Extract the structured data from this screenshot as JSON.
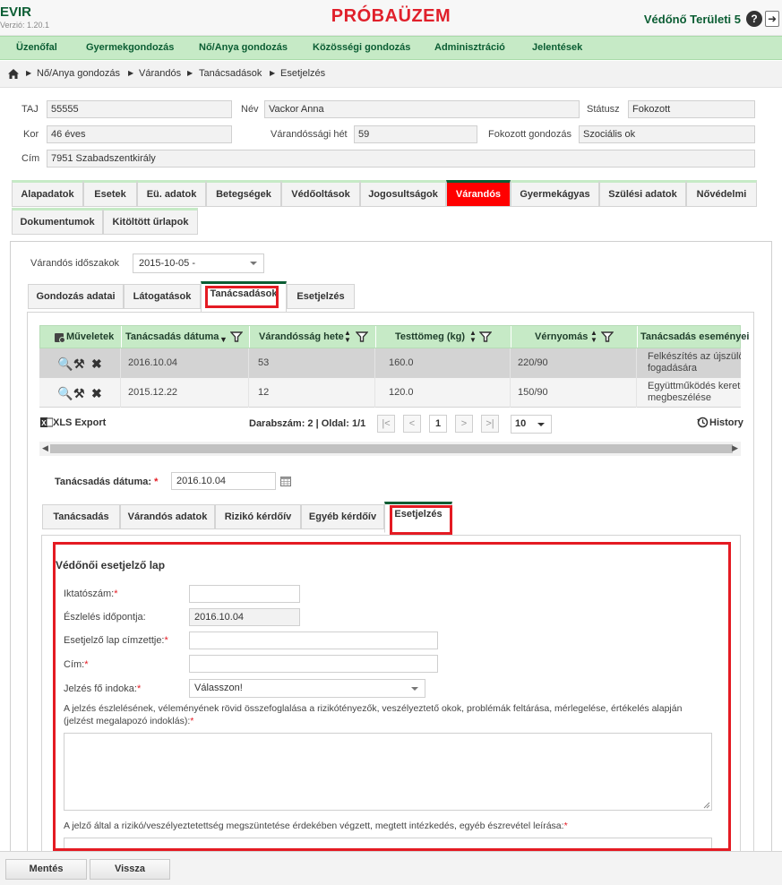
{
  "header": {
    "app_name": "EVIR",
    "version": "Verzió: 1.20.1",
    "env_banner": "PRÓBAÜZEM",
    "user": "Védőnő Területi 5",
    "help": "?",
    "logout": "➜"
  },
  "main_menu": [
    "Üzenőfal",
    "Gyermekgondozás",
    "Nő/Anya gondozás",
    "Közösségi gondozás",
    "Adminisztráció",
    "Jelentések"
  ],
  "breadcrumb": [
    "Nő/Anya gondozás",
    "Várandós",
    "Tanácsadások",
    "Esetjelzés"
  ],
  "patient": {
    "taj_label": "TAJ",
    "taj": "55555",
    "name_label": "Név",
    "name": "Vackor Anna",
    "status_label": "Státusz",
    "status": "Fokozott",
    "age_label": "Kor",
    "age": "46 éves",
    "week_label": "Várandóssági hét",
    "week": "59",
    "extra_care_label": "Fokozott gondozás",
    "extra_care": "Szociális ok",
    "address_label": "Cím",
    "address": "7951 Szabadszentkirály"
  },
  "tabs_level1": [
    "Alapadatok",
    "Esetek",
    "Eü. adatok",
    "Betegségek",
    "Védőoltások",
    "Jogosultságok",
    "Várandós",
    "Gyermekágyas",
    "Szülési adatok",
    "Nővédelmi",
    "Dokumentumok",
    "Kitöltött űrlapok"
  ],
  "periods": {
    "label": "Várandós időszakok",
    "value": "2015-10-05 -"
  },
  "tabs_level2": [
    "Gondozás adatai",
    "Látogatások",
    "Tanácsadások",
    "Esetjelzés"
  ],
  "table": {
    "headers": [
      "Műveletek",
      "Tanácsadás dátuma",
      "Várandósság hete",
      "Testtömeg (kg)",
      "Vérnyomás",
      "Tanácsadás eseményei"
    ],
    "rows": [
      {
        "date": "2016.10.04",
        "week": "53",
        "weight": "160.0",
        "bp": "220/90",
        "event_l1": "Felkészítés az újszülött",
        "event_l2": "fogadására"
      },
      {
        "date": "2015.12.22",
        "week": "12",
        "weight": "120.0",
        "bp": "150/90",
        "event_l1": "Együttműködés keretei",
        "event_l2": "megbeszélése"
      }
    ],
    "actions": {
      "view": "🔍",
      "edit": "⚒",
      "delete": "✖"
    }
  },
  "pager": {
    "export": "XLS Export",
    "count": "Darabszám: 2 | Oldal: 1/1",
    "first": "|<",
    "prev": "<",
    "page": "1",
    "next": ">",
    "last": ">|",
    "page_size": "10",
    "history": "History"
  },
  "consult_date": {
    "label": "Tanácsadás dátuma:",
    "value": "2016.10.04"
  },
  "tabs_level3": [
    "Tanácsadás",
    "Várandós adatok",
    "Rizikó kérdőív",
    "Egyéb kérdőív",
    "Esetjelzés"
  ],
  "form": {
    "title": "Védőnői esetjelző lap",
    "filing_label": "Iktatószám:",
    "detection_label": "Észlelés időpontja:",
    "detection_value": "2016.10.04",
    "recipient_label": "Esetjelző lap címzettje:",
    "address_label": "Cím:",
    "reason_label": "Jelzés fő indoka:",
    "reason_value": "Válasszon!",
    "summary_label_1": "A jelzés észlelésének, véleményének rövid összefoglalása a rizikótényezők, veszélyeztető okok, problémák feltárása, mérlegelése, értékelés alapján",
    "summary_label_2": "(jelzést megalapozó indoklás):",
    "measures_label": "A jelző által a rizikó/veszélyeztetettség megszüntetése érdekében végzett, megtett intézkedés, egyéb észrevétel leírása:",
    "required_mark": "*"
  },
  "footer": {
    "save": "Mentés",
    "back": "Vissza"
  },
  "colors": {
    "brand_green": "#0b5d33",
    "menu_bg": "#c6eac6",
    "banner_red": "#e0202b",
    "active_tab": "#ff0000",
    "highlight_box": "#e41b23"
  }
}
